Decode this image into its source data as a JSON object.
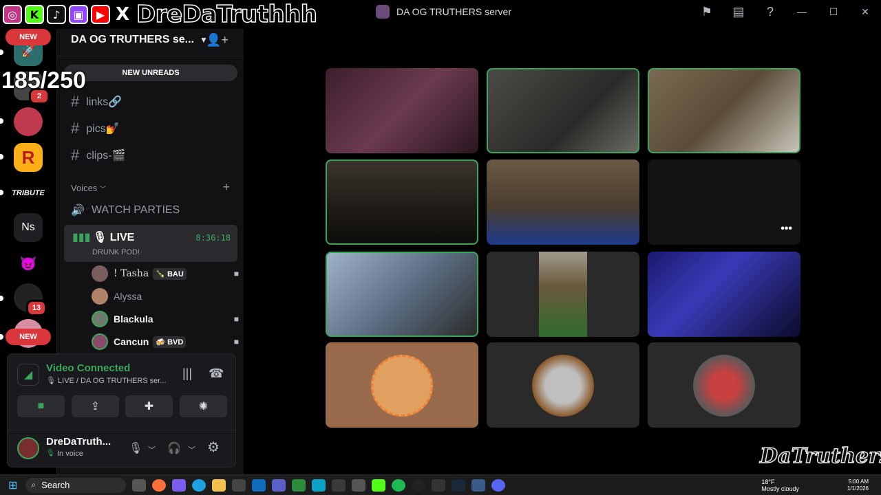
{
  "overlay": {
    "handle": "DreDaTruthhh",
    "counter": "185/250",
    "socials": [
      {
        "name": "instagram-icon",
        "glyph": "◎",
        "color": "#c13584"
      },
      {
        "name": "kick-icon",
        "glyph": "K",
        "color": "#53fc18"
      },
      {
        "name": "tiktok-icon",
        "glyph": "♪",
        "color": "#111111"
      },
      {
        "name": "twitch-icon",
        "glyph": "▣",
        "color": "#9146ff"
      },
      {
        "name": "youtube-icon",
        "glyph": "▶",
        "color": "#ff0000"
      },
      {
        "name": "x-icon",
        "glyph": "X",
        "color": "#000000"
      }
    ]
  },
  "titlebar": {
    "title": "DA OG TRUTHERS server"
  },
  "rail": {
    "new_top": "NEW",
    "new_bottom": "NEW",
    "badge_a": "2",
    "badge_b": "13",
    "tribute": "TRIBUTE",
    "ns": "Ns",
    "r": "R"
  },
  "sidebar": {
    "server_name": "DA OG TRUTHERS se...",
    "new_unreads": "NEW UNREADS",
    "channels": [
      {
        "name": "links🔗"
      },
      {
        "name": "pics💅"
      },
      {
        "name": "clips-🎬"
      }
    ],
    "category": "Voices",
    "watch_parties": "WATCH PARTIES",
    "live": {
      "name": "🎙 LIVE",
      "timer": "8:36:18",
      "sub": "DRUNK POD!"
    },
    "voice_users": [
      {
        "name": "! Tasha",
        "tag": "🍾 BAU",
        "color": "#dbdee1"
      },
      {
        "name": "Alyssa",
        "tag": "",
        "color": "#949ba4"
      },
      {
        "name": "Blackula",
        "tag": "",
        "color": "#f2f3f5"
      },
      {
        "name": "Cancun",
        "tag": "🍻 BVD",
        "color": "#f2f3f5"
      }
    ]
  },
  "voice_panel": {
    "status": "Video Connected",
    "location": "🎙 LIVE / DA OG TRUTHERS ser...",
    "username": "DreDaTruth...",
    "user_status": "In voice"
  },
  "taskbar": {
    "search": "Search",
    "weather_temp": "18°F",
    "weather_desc": "Mostly cloudy",
    "time": "5:00 AM",
    "date": "1/1/2026"
  },
  "watermark": "DaTruthers",
  "colors": {
    "accent_green": "#3ba55c",
    "danger_red": "#da373c"
  }
}
